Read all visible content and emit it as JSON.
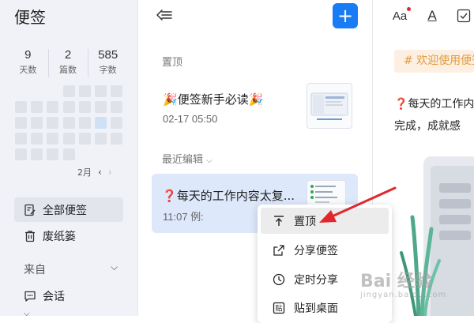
{
  "app": {
    "title": "便签"
  },
  "stats": [
    {
      "value": "9",
      "label": "天数"
    },
    {
      "value": "2",
      "label": "篇数"
    },
    {
      "value": "585",
      "label": "字数"
    }
  ],
  "calendar": {
    "month_label": "2月",
    "prev_icon": "chevron-left-icon",
    "next_icon": "chevron-right-icon"
  },
  "sidebar": {
    "all_notes": "全部便签",
    "trash": "废纸篓",
    "section_from": "来自",
    "chat": "会话"
  },
  "list": {
    "pinned_header": "置顶",
    "pinned_note": {
      "title": "便签新手必读",
      "date": "02-17 05:50"
    },
    "recent_header": "最近编辑",
    "recent_note": {
      "title": "每天的工作内容太复...",
      "preview": "11:07 例:"
    }
  },
  "context_menu": {
    "items": [
      {
        "label": "置顶",
        "icon": "pin-top-icon"
      },
      {
        "label": "分享便签",
        "icon": "share-icon"
      },
      {
        "label": "定时分享",
        "icon": "clock-icon"
      },
      {
        "label": "贴到桌面",
        "icon": "paste-desktop-icon"
      }
    ]
  },
  "editor": {
    "toolbar": {
      "font_size_label": "Aa",
      "font_color_label": "A"
    },
    "tag_banner": "# 欢迎使用便签",
    "line1": "每天的工作内",
    "line2": "完成，成就感"
  },
  "watermark": {
    "main": "Bai 经验",
    "sub": "jingyan.baidu.com"
  },
  "colors": {
    "accent": "#1a7cf5",
    "selected_card": "#dde8fb",
    "tag_text": "#e29a3b",
    "arrow": "#e0282c"
  }
}
